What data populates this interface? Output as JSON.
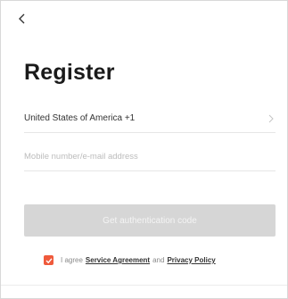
{
  "header": {
    "back_icon": "chevron-left-icon",
    "title": "Register"
  },
  "form": {
    "country_label": "United States of America +1",
    "country_chevron_icon": "chevron-right-icon",
    "account_placeholder": "Mobile number/e-mail address",
    "account_value": "",
    "submit_label": "Get authentication code"
  },
  "agreement": {
    "checked": true,
    "prefix": "I agree",
    "service_link": "Service Agreement",
    "conjunction": "and",
    "privacy_link": "Privacy Policy"
  },
  "colors": {
    "accent": "#ef5a3c",
    "button_disabled": "#d6d6d6",
    "divider": "#e6e6e6"
  }
}
